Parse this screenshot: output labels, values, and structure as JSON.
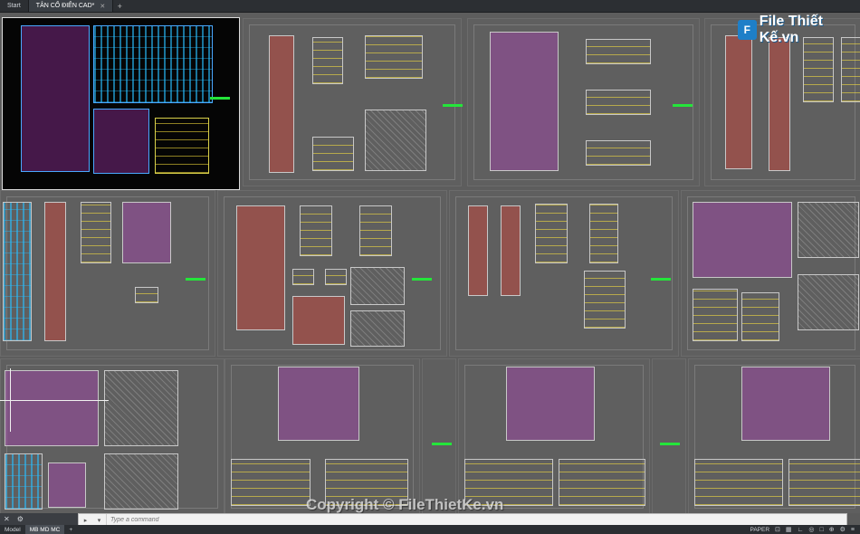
{
  "tabs": [
    {
      "label": "Start",
      "active": false
    },
    {
      "label": "TÂN CỔ ĐIỂN CAD*",
      "active": true
    }
  ],
  "command": {
    "placeholder": "Type a command"
  },
  "layout_tabs": [
    {
      "label": "Model",
      "active": false
    },
    {
      "label": "MB MD MC",
      "active": true
    }
  ],
  "status": {
    "space": "PAPER"
  },
  "logo": {
    "badge": "F",
    "text": "File Thiết Kế.vn"
  },
  "watermark": "Copyright © FileThietKe.vn",
  "icons": [
    "close-icon",
    "plus-icon",
    "settings-icon",
    "snap-icon",
    "grid-icon",
    "ortho-icon",
    "zoom-icon",
    "menu-icon"
  ]
}
